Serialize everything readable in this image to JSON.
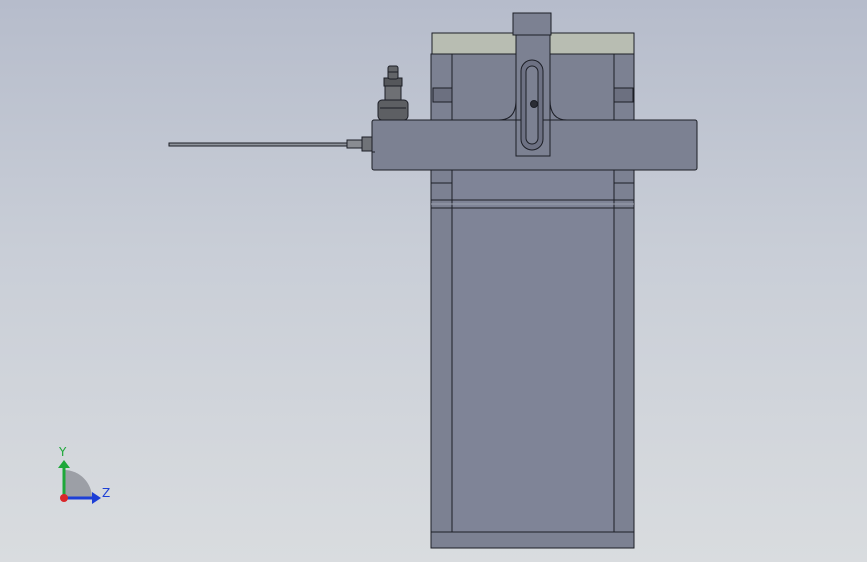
{
  "viewport": {
    "orientation": {
      "axis_y_label": "Y",
      "axis_z_label": "Z"
    }
  },
  "colors": {
    "background_top": "#b6bccb",
    "background_bottom": "#d9dcdf",
    "model_body": "#7c8192",
    "model_edge": "#1c1e26",
    "top_plate": "#b8bdb2",
    "fitting": "#5d5f63",
    "axis_y": "#1ea83a",
    "axis_z": "#1d3fd6",
    "axis_x_dot": "#d9262a"
  }
}
